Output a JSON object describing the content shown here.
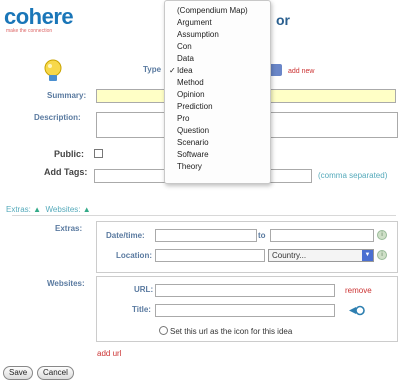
{
  "logo": {
    "name": "cohere",
    "tagline": "make the connection"
  },
  "title_tail": "or",
  "type_row": {
    "label": "Type",
    "add_new": "add new"
  },
  "type_menu": {
    "items": [
      "(Compendium Map)",
      "Argument",
      "Assumption",
      "Con",
      "Data",
      "Idea",
      "Method",
      "Opinion",
      "Prediction",
      "Pro",
      "Question",
      "Scenario",
      "Software",
      "Theory"
    ],
    "selected": "Idea"
  },
  "form": {
    "summary_label": "Summary:",
    "summary_value": "",
    "description_label": "Description:",
    "description_value": "",
    "public_label": "Public:",
    "tags_label": "Add Tags:",
    "tags_value": "",
    "tags_hint": "(comma separated)"
  },
  "toggles": {
    "extras": "Extras:",
    "websites": "Websites:"
  },
  "extras": {
    "label": "Extras:",
    "datetime_label": "Date/time:",
    "to_label": "to",
    "location_label": "Location:",
    "country_value": "Country..."
  },
  "websites": {
    "label": "Websites:",
    "url_label": "URL:",
    "title_label": "Title:",
    "remove": "remove",
    "set_icon": "Set this url as the icon for this idea",
    "add_url": "add url"
  },
  "buttons": {
    "save": "Save",
    "cancel": "Cancel"
  },
  "colors": {
    "brand": "#1a76b8",
    "link": "#cc3333",
    "summary_bg": "#ffffc6"
  }
}
